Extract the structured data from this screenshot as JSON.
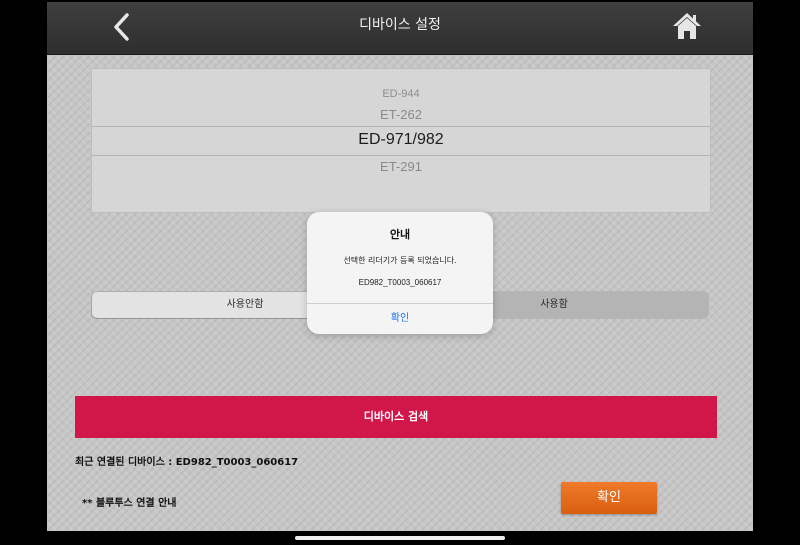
{
  "header": {
    "title": "디바이스 설정",
    "back_icon": "chevron-left-icon",
    "home_icon": "home-icon"
  },
  "picker": {
    "items": [
      "ED-944",
      "ET-262",
      "ED-971/982",
      "ET-291"
    ],
    "selected": "ED-971/982"
  },
  "segment": {
    "options": [
      "사용안함",
      "사용함"
    ],
    "selected": "사용안함"
  },
  "search_button": "디바이스 검색",
  "recent_device": "최근 연결된 디바이스 : ED982_T0003_060617",
  "bluetooth_guide": "** 블루투스 연결 안내",
  "confirm_button": "확인",
  "dialog": {
    "title": "안내",
    "message": "선택한 리더기가 등록 되었습니다.",
    "detail": "ED982_T0003_060617",
    "ok": "확인"
  },
  "colors": {
    "accent": "#d1164a",
    "confirm": "#e06a1b",
    "dialog_link": "#1a73e8"
  }
}
